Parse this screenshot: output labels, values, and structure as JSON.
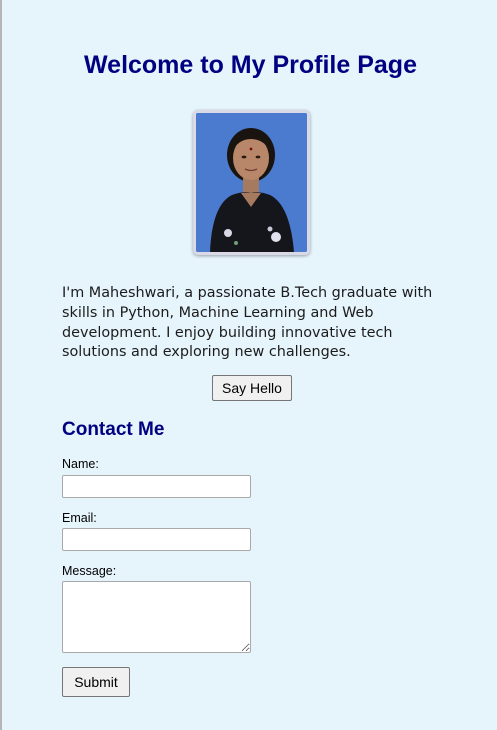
{
  "header": {
    "title": "Welcome to My Profile Page"
  },
  "profile": {
    "photo_icon": "profile-photo",
    "bio": "I'm Maheshwari, a passionate B.Tech graduate with skills in Python, Machine Learning and Web development. I enjoy building innovative tech solutions and exploring new challenges.",
    "say_hello_label": "Say Hello"
  },
  "contact": {
    "heading": "Contact Me",
    "name_label": "Name:",
    "name_value": "",
    "email_label": "Email:",
    "email_value": "",
    "message_label": "Message:",
    "message_value": "",
    "submit_label": "Submit"
  },
  "colors": {
    "background": "#e6f4fc",
    "heading": "#000080",
    "button_bg": "#f0f0f0"
  }
}
